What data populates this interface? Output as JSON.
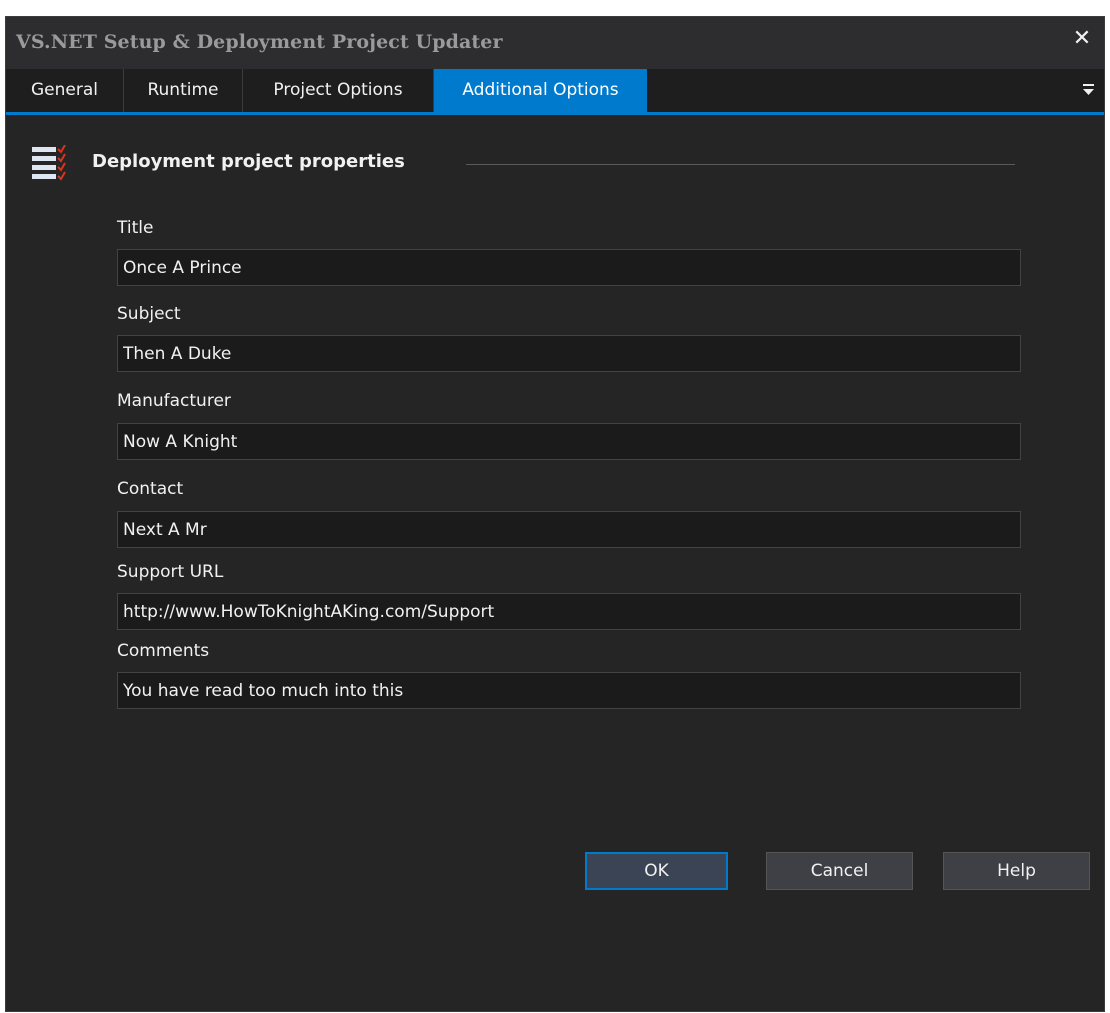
{
  "window": {
    "title": "VS.NET Setup & Deployment Project Updater",
    "close_glyph": "✕"
  },
  "tabs": [
    {
      "label": "General",
      "active": false
    },
    {
      "label": "Runtime",
      "active": false
    },
    {
      "label": "Project Options",
      "active": false
    },
    {
      "label": "Additional Options",
      "active": true
    }
  ],
  "section": {
    "title": "Deployment project properties",
    "icon": "checklist-icon"
  },
  "fields": [
    {
      "label": "Title",
      "value": "Once A Prince"
    },
    {
      "label": "Subject",
      "value": "Then A Duke"
    },
    {
      "label": "Manufacturer",
      "value": "Now A Knight"
    },
    {
      "label": "Contact",
      "value": "Next A Mr"
    },
    {
      "label": "Support URL",
      "value": "http://www.HowToKnightAKing.com/Support"
    },
    {
      "label": "Comments",
      "value": "You have read too much into this"
    }
  ],
  "buttons": {
    "ok": "OK",
    "cancel": "Cancel",
    "help": "Help"
  },
  "colors": {
    "background": "#252526",
    "accent": "#007acc",
    "input_background": "#1b1b1c",
    "check_red": "#d9341c"
  }
}
